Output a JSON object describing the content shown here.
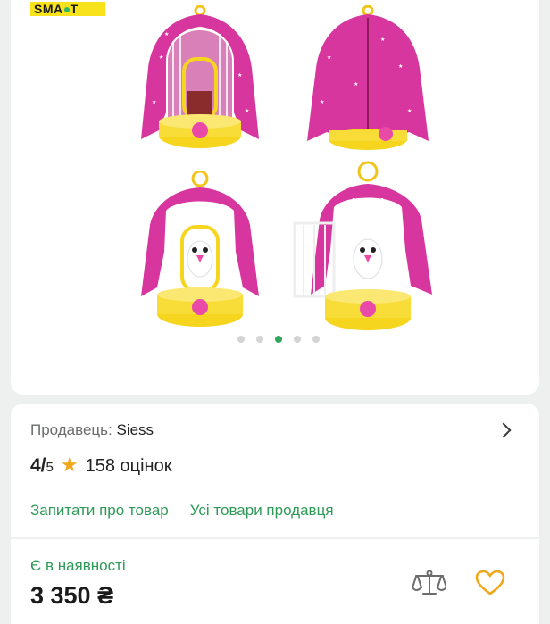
{
  "gallery": {
    "badge": "SMART",
    "slides_count": 5,
    "active_slide": 3
  },
  "seller": {
    "prefix": "Продавець:",
    "name": "Siess",
    "rating_score": "4/",
    "rating_max": "5",
    "reviews": "158 оцінок",
    "ask_link": "Запитати про товар",
    "all_goods_link": "Усі товари продавця"
  },
  "buy": {
    "stock": "Є в наявності",
    "price": "3 350 ₴"
  },
  "colors": {
    "accent": "#2f9a58",
    "cape": "#d8369f",
    "base": "#f6d51e"
  },
  "icons": [
    "chevron-right-icon",
    "star-icon",
    "compare-scales-icon",
    "heart-icon"
  ]
}
